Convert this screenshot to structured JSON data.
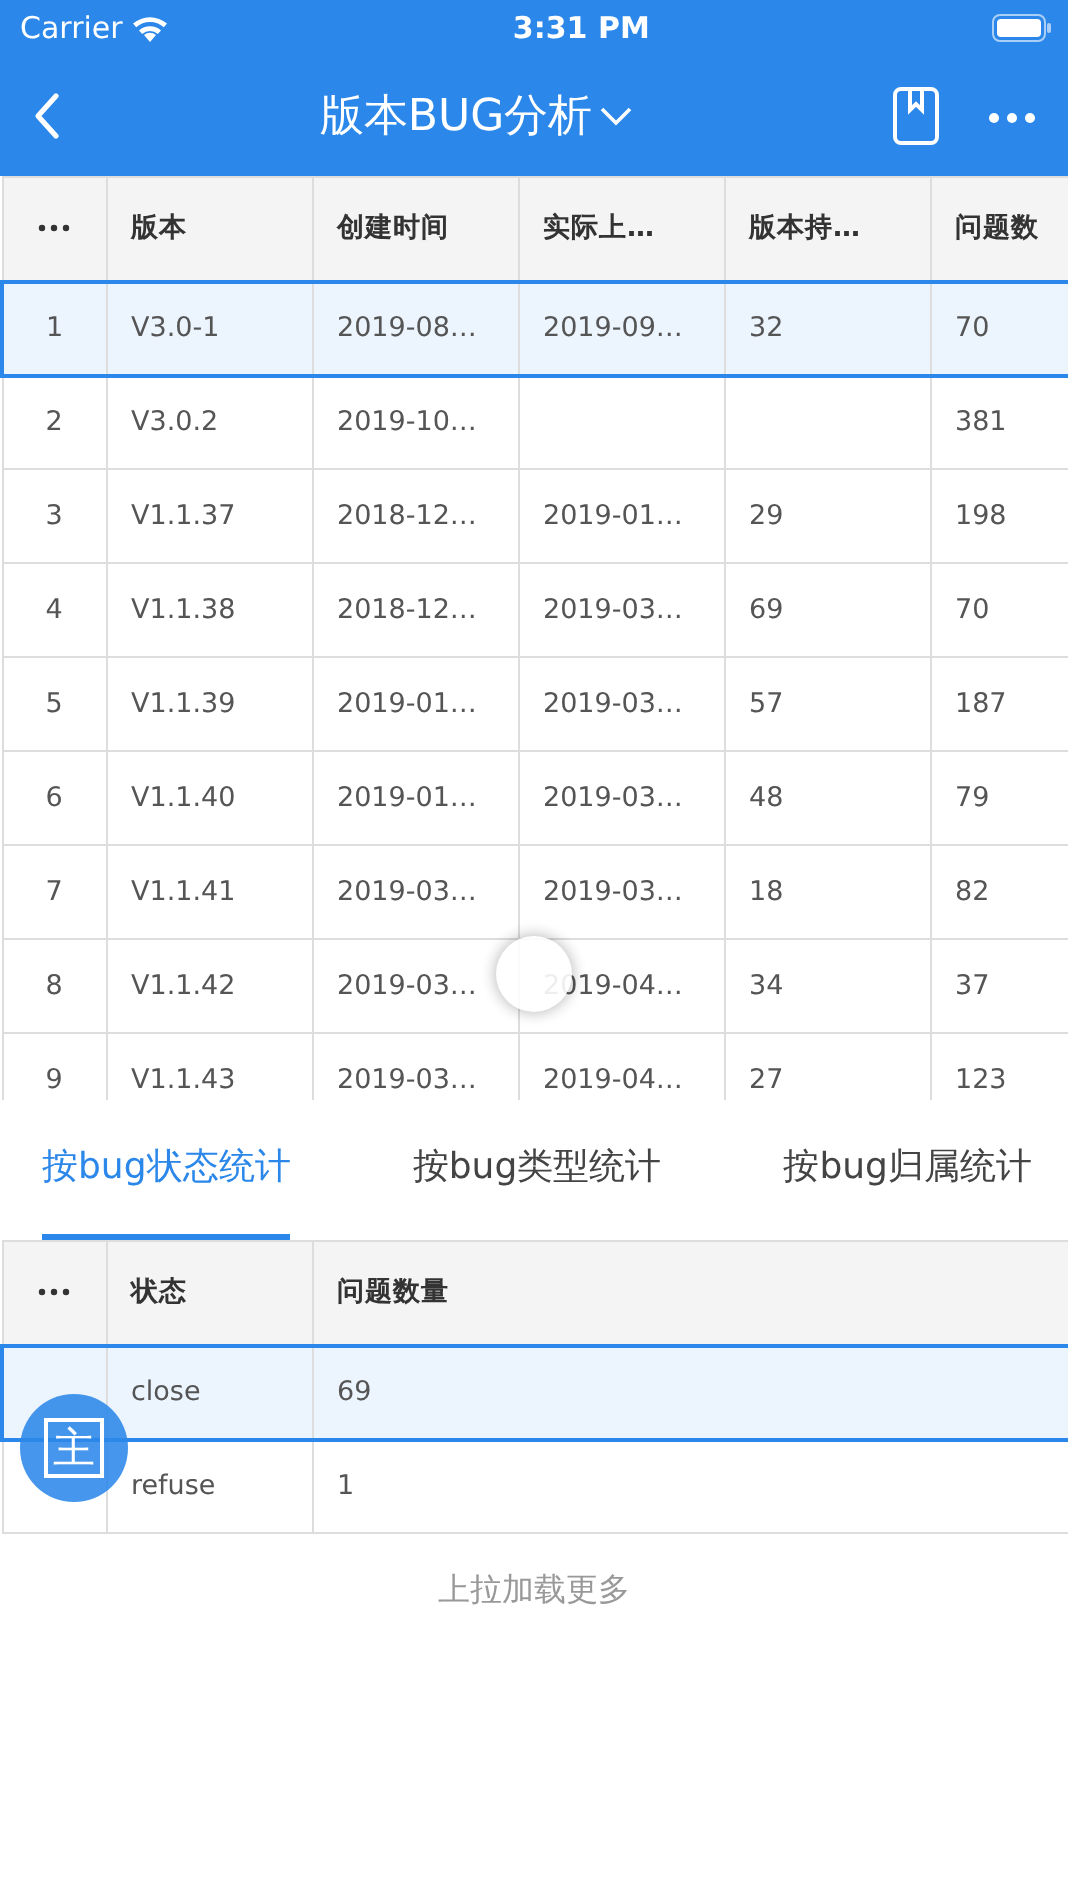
{
  "status_bar": {
    "carrier": "Carrier",
    "time": "3:31 PM"
  },
  "nav": {
    "title": "版本BUG分析"
  },
  "main_table": {
    "columns": [
      "版本",
      "创建时间",
      "实际上…",
      "版本持…",
      "问题数"
    ],
    "rows": [
      {
        "index": "1",
        "cells": [
          "V3.0-1",
          "2019-08…",
          "2019-09…",
          "32",
          "70"
        ],
        "selected": true
      },
      {
        "index": "2",
        "cells": [
          "V3.0.2",
          "2019-10…",
          "",
          "",
          "381"
        ],
        "selected": false
      },
      {
        "index": "3",
        "cells": [
          "V1.1.37",
          "2018-12…",
          "2019-01…",
          "29",
          "198"
        ],
        "selected": false
      },
      {
        "index": "4",
        "cells": [
          "V1.1.38",
          "2018-12…",
          "2019-03…",
          "69",
          "70"
        ],
        "selected": false
      },
      {
        "index": "5",
        "cells": [
          "V1.1.39",
          "2019-01…",
          "2019-03…",
          "57",
          "187"
        ],
        "selected": false
      },
      {
        "index": "6",
        "cells": [
          "V1.1.40",
          "2019-01…",
          "2019-03…",
          "48",
          "79"
        ],
        "selected": false
      },
      {
        "index": "7",
        "cells": [
          "V1.1.41",
          "2019-03…",
          "2019-03…",
          "18",
          "82"
        ],
        "selected": false
      },
      {
        "index": "8",
        "cells": [
          "V1.1.42",
          "2019-03…",
          "2019-04…",
          "34",
          "37"
        ],
        "selected": false
      },
      {
        "index": "9",
        "cells": [
          "V1.1.43",
          "2019-03…",
          "2019-04…",
          "27",
          "123"
        ],
        "selected": false
      }
    ]
  },
  "tabs": [
    {
      "label": "按bug状态统计",
      "selected": true
    },
    {
      "label": "按bug类型统计",
      "selected": false
    },
    {
      "label": "按bug归属统计",
      "selected": false
    }
  ],
  "stat_table": {
    "columns": [
      "状态",
      "问题数量"
    ],
    "rows": [
      {
        "cells": [
          "close",
          "69"
        ],
        "selected": true
      },
      {
        "cells": [
          "refuse",
          "1"
        ],
        "selected": false
      }
    ]
  },
  "load_more": "上拉加载更多",
  "fab": {
    "label": "主"
  }
}
